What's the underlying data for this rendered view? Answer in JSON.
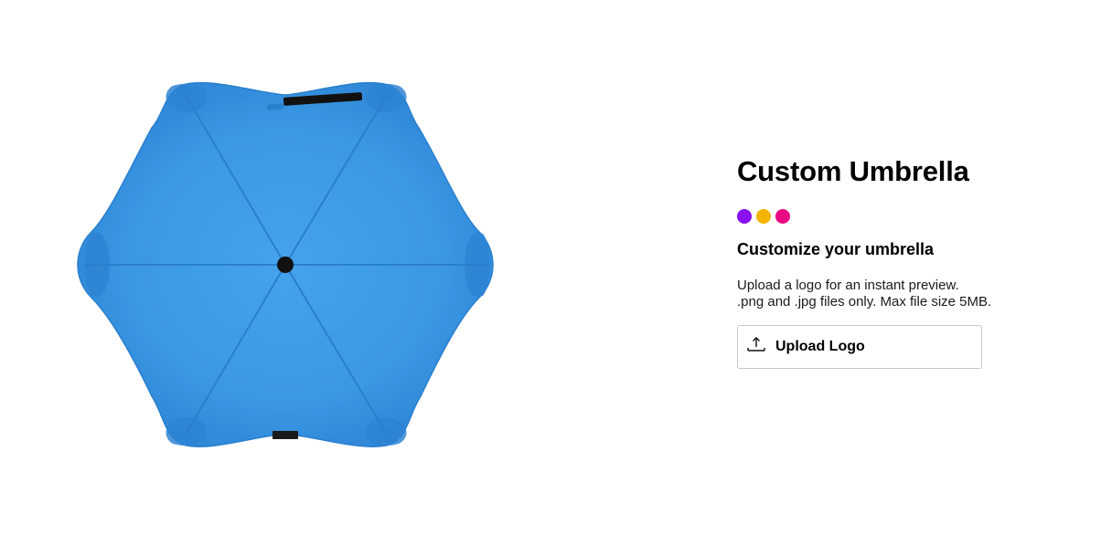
{
  "product": {
    "title": "Custom Umbrella",
    "image_alt": "Blue umbrella, top view",
    "umbrella_color": "#3a97e4"
  },
  "swatches": [
    {
      "name": "purple",
      "color": "#8b10f0"
    },
    {
      "name": "amber",
      "color": "#f5b400"
    },
    {
      "name": "magenta",
      "color": "#ea0a83"
    }
  ],
  "customize": {
    "heading": "Customize your umbrella",
    "description_line1": "Upload a logo for an instant preview.",
    "description_line2": ".png and .jpg files only. Max file size 5MB.",
    "upload_button_label": "Upload Logo",
    "upload_icon": "upload-icon"
  }
}
